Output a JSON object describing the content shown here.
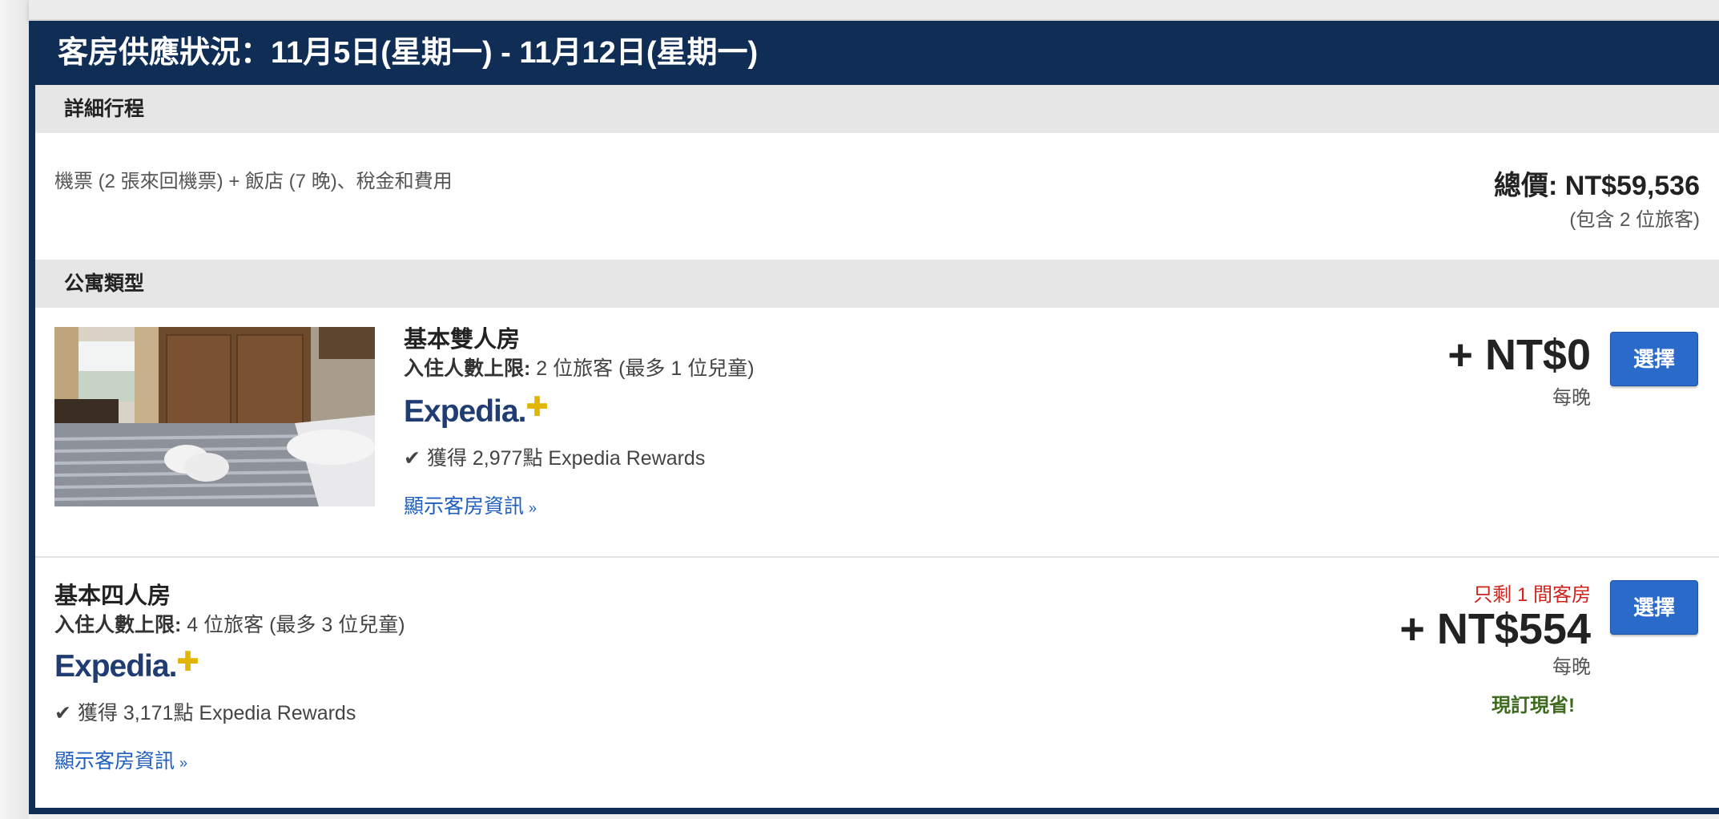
{
  "availability": {
    "title": "客房供應狀況：11月5日(星期一) - 11月12日(星期一)"
  },
  "itinerary": {
    "header": "詳細行程",
    "description": "機票 (2 張來回機票) + 飯店 (7 晚)、稅金和費用",
    "total_price": "總價: NT$59,536",
    "total_sub": "(包含 2 位旅客)"
  },
  "room_type_header": "公寓類型",
  "rooms": [
    {
      "name": "基本雙人房",
      "occupancy_label": "入住人數上限:",
      "occupancy_value": " 2 位旅客 (最多 1 位兒童)",
      "logo_text": "Expedia",
      "rewards": "獲得 2,977點 Expedia Rewards",
      "show_info": "顯示客房資訊",
      "price": "+ NT$0",
      "per_night": "每晚",
      "select_label": "選擇"
    },
    {
      "name": "基本四人房",
      "occupancy_label": "入住人數上限:",
      "occupancy_value": " 4 位旅客 (最多 3 位兒童)",
      "logo_text": "Expedia",
      "rewards": "獲得 3,171點 Expedia Rewards",
      "show_info": "顯示客房資訊",
      "few_left": "只剩 1 間客房",
      "price": "+ NT$554",
      "per_night": "每晚",
      "promo": "現訂現省!",
      "select_label": "選擇"
    }
  ],
  "icons": {
    "check": "check-icon",
    "chevron": "double-chevron-down-icon",
    "logo_plus": "plus-icon"
  },
  "colors": {
    "header_bg": "#102e55",
    "button": "#2a6ac8",
    "link": "#1f5fbf",
    "alert": "#d0221b",
    "promo": "#3d6a1d",
    "logo_plus": "#e2b600"
  }
}
